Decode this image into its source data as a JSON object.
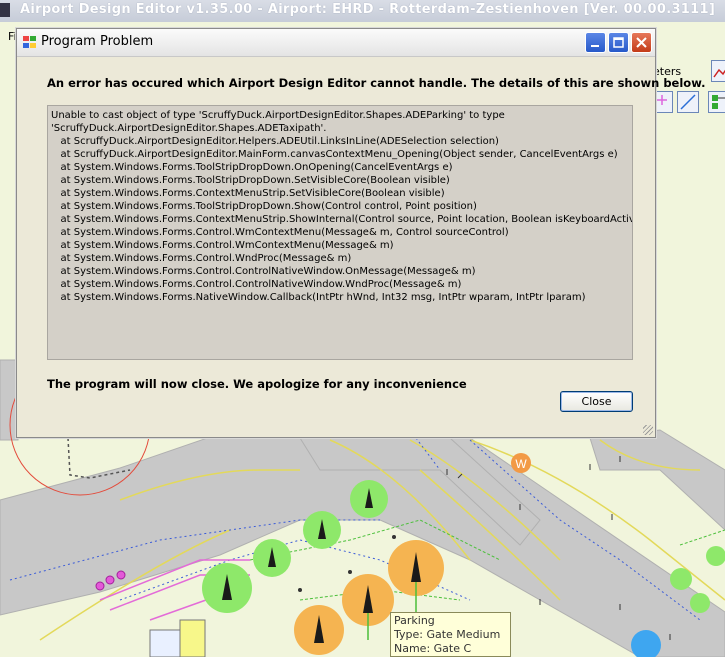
{
  "main_window": {
    "title": "Airport Design Editor  v1.35.00  -  Airport: EHRD - Rotterdam-Zestienhoven [Ver. 00.00.3111]",
    "menu_fragment": "Fi",
    "meters_fragment": "eters"
  },
  "dialog": {
    "title": "Program Problem",
    "intro": "An error has occured which Airport Design Editor cannot handle.  The details of this are shown below.",
    "details_lines": [
      "Unable to cast object of type 'ScruffyDuck.AirportDesignEditor.Shapes.ADEParking' to type",
      "'ScruffyDuck.AirportDesignEditor.Shapes.ADETaxipath'.",
      "",
      "   at ScruffyDuck.AirportDesignEditor.Helpers.ADEUtil.LinksInLine(ADESelection selection)",
      "   at ScruffyDuck.AirportDesignEditor.MainForm.canvasContextMenu_Opening(Object sender, CancelEventArgs e)",
      "   at System.Windows.Forms.ToolStripDropDown.OnOpening(CancelEventArgs e)",
      "   at System.Windows.Forms.ToolStripDropDown.SetVisibleCore(Boolean visible)",
      "   at System.Windows.Forms.ContextMenuStrip.SetVisibleCore(Boolean visible)",
      "   at System.Windows.Forms.ToolStripDropDown.Show(Control control, Point position)",
      "   at System.Windows.Forms.ContextMenuStrip.ShowInternal(Control source, Point location, Boolean isKeyboardActivated)",
      "   at System.Windows.Forms.Control.WmContextMenu(Message& m, Control sourceControl)",
      "   at System.Windows.Forms.Control.WmContextMenu(Message& m)",
      "   at System.Windows.Forms.Control.WndProc(Message& m)",
      "   at System.Windows.Forms.Control.ControlNativeWindow.OnMessage(Message& m)",
      "   at System.Windows.Forms.Control.ControlNativeWindow.WndProc(Message& m)",
      "   at System.Windows.Forms.NativeWindow.Callback(IntPtr hWnd, Int32 msg, IntPtr wparam, IntPtr lparam)"
    ],
    "closing_message": "The program will now close.  We apologize for any inconvenience",
    "close_label": "Close"
  },
  "map": {
    "marker_label": "W",
    "tooltip": {
      "line1": "Parking",
      "line2": "Type: Gate Medium",
      "line3": "Name: Gate C"
    }
  },
  "colors": {
    "map_background": "#f1f5dc",
    "taxiway": "#c8c8c8",
    "gate_orange": "#f5b451",
    "gate_green": "#8ee86a",
    "dialog_face": "#ece9d8"
  }
}
